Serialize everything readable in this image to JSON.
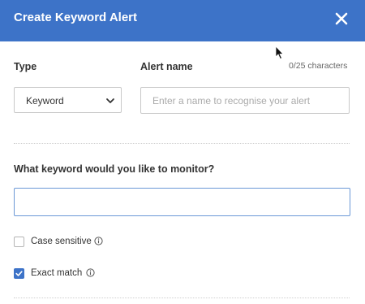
{
  "dialog": {
    "title": "Create Keyword Alert",
    "close_icon": "close-icon"
  },
  "type_field": {
    "label": "Type",
    "selected": "Keyword",
    "icon": "chevron-down-icon"
  },
  "alert_name": {
    "label": "Alert name",
    "counter": "0/25 characters",
    "value": "",
    "placeholder": "Enter a name to recognise your alert"
  },
  "keyword": {
    "question": "What keyword would you like to monitor?",
    "value": ""
  },
  "options": {
    "case_sensitive": {
      "label": "Case sensitive",
      "checked": false,
      "icon": "info-icon"
    },
    "exact_match": {
      "label": "Exact match",
      "checked": true,
      "icon": "info-icon"
    }
  },
  "colors": {
    "header": "#3d73c8",
    "accent": "#3d73c8",
    "focus_border": "#6b98d6"
  }
}
